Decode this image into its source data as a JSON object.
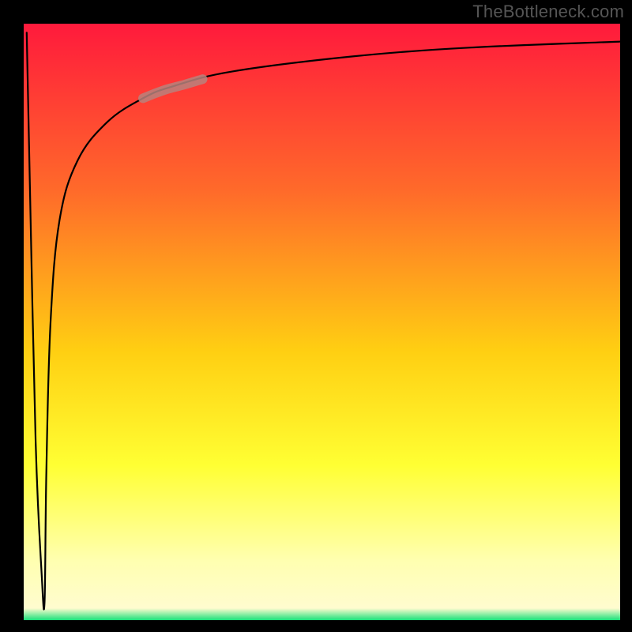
{
  "watermark": "TheBottleneck.com",
  "colors": {
    "frame": "#000000",
    "watermark": "#555555",
    "gradient_top": "#ff1a3c",
    "gradient_mid_upper": "#ff6a2a",
    "gradient_mid": "#ffcf12",
    "gradient_mid_lower": "#ffff33",
    "gradient_lower": "#fffccf",
    "gradient_bottom": "#18e07a",
    "curve": "#000000",
    "highlight": "#b9827d"
  },
  "chart_data": {
    "type": "line",
    "title": "",
    "xlabel": "",
    "ylabel": "",
    "xlim": [
      0,
      100
    ],
    "ylim": [
      0,
      100
    ],
    "series": [
      {
        "name": "bottleneck-curve-left",
        "x": [
          0.5,
          1.0,
          2.0,
          3.0,
          3.5
        ],
        "values": [
          98.5,
          75.0,
          30.0,
          8.0,
          3.0
        ]
      },
      {
        "name": "bottleneck-curve-right",
        "x": [
          3.5,
          3.8,
          4.5,
          6.0,
          9.0,
          14.0,
          20.0,
          25.0,
          35.0,
          55.0,
          75.0,
          100.0
        ],
        "values": [
          3.0,
          25.0,
          50.0,
          67.0,
          77.0,
          83.5,
          87.5,
          89.5,
          92.0,
          94.5,
          96.0,
          97.0
        ]
      }
    ],
    "annotations": [
      {
        "name": "highlight-segment",
        "x": [
          20.0,
          22.0,
          24.0,
          27.0,
          30.0
        ],
        "values": [
          87.5,
          88.3,
          89.0,
          89.8,
          90.7
        ]
      }
    ]
  }
}
